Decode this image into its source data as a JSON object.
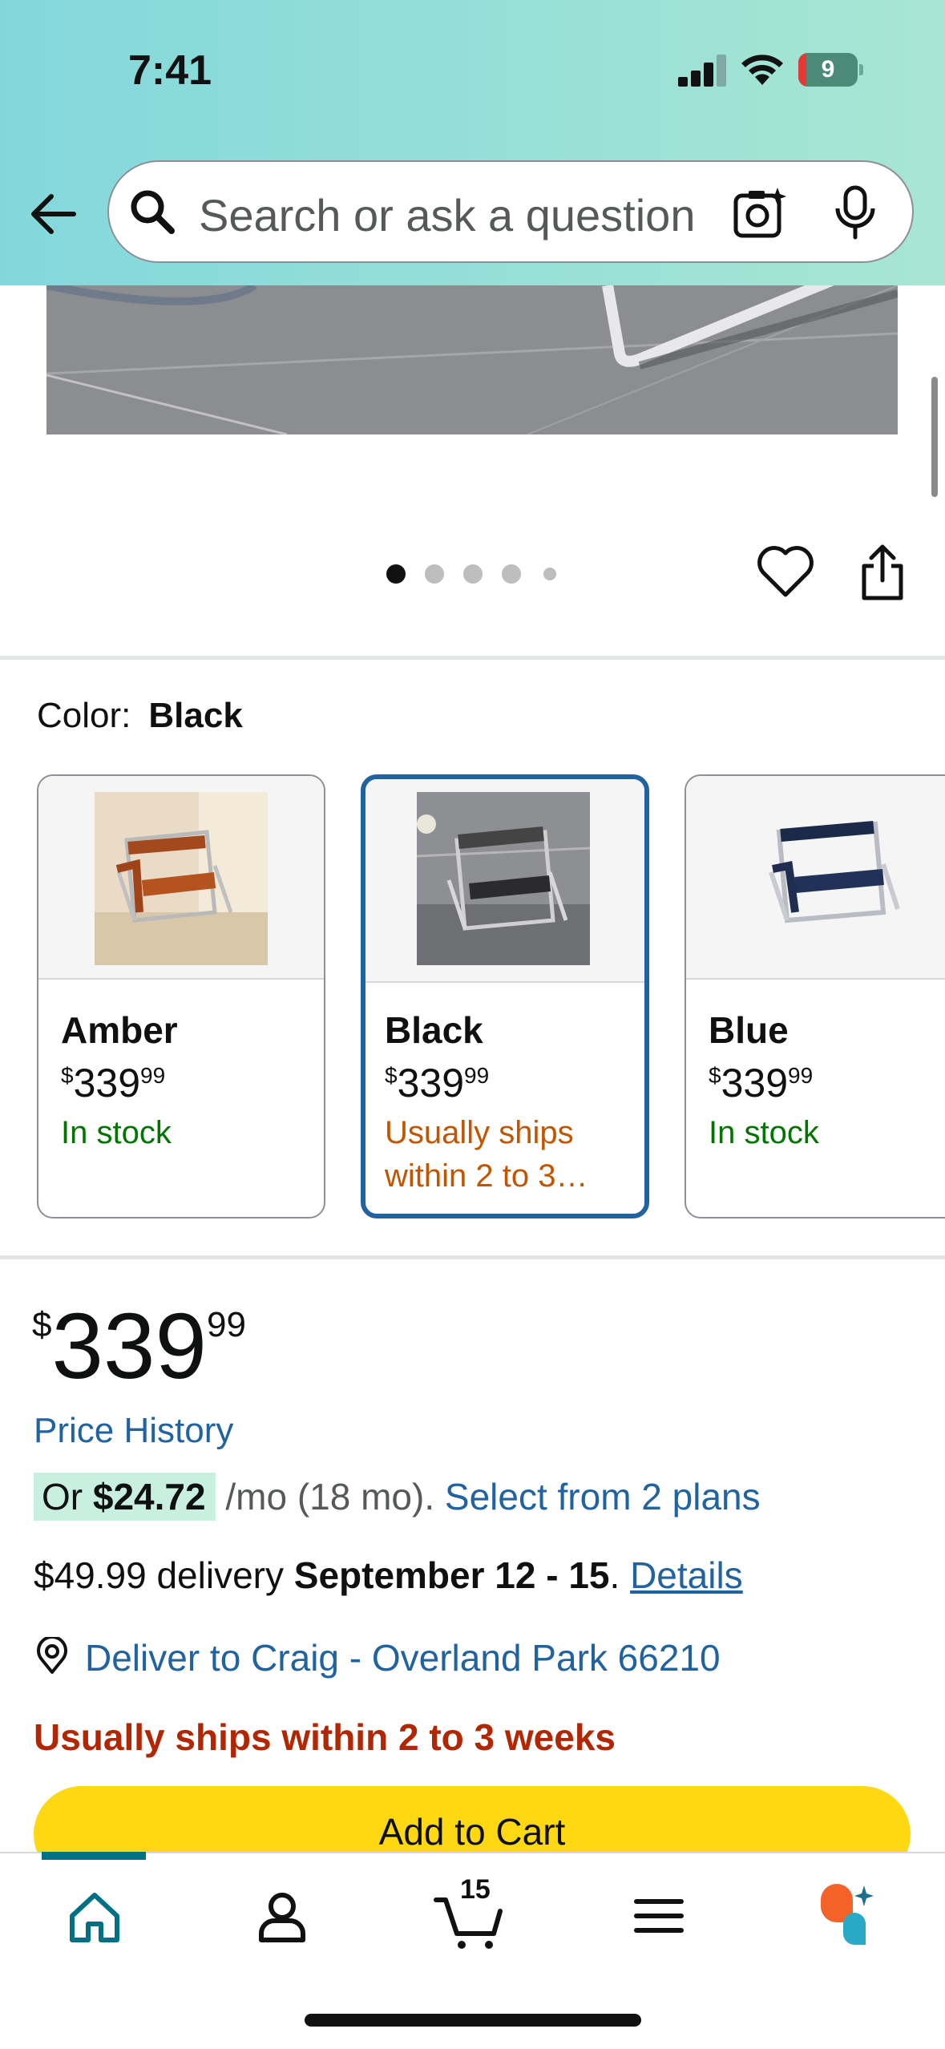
{
  "status_bar": {
    "time": "7:41",
    "battery_level": "9"
  },
  "search": {
    "placeholder": "Search or ask a question"
  },
  "image_pager": {
    "count": 5,
    "active_index": 0
  },
  "color_selector": {
    "label": "Color:",
    "selected": "Black",
    "options": [
      {
        "name": "Amber",
        "price_currency": "$",
        "price_whole": "339",
        "price_fraction": "99",
        "availability": "In stock",
        "selected": false
      },
      {
        "name": "Black",
        "price_currency": "$",
        "price_whole": "339",
        "price_fraction": "99",
        "availability": "Usually ships within 2 to 3…",
        "selected": true
      },
      {
        "name": "Blue",
        "price_currency": "$",
        "price_whole": "339",
        "price_fraction": "99",
        "availability": "In stock",
        "selected": false
      }
    ]
  },
  "price": {
    "currency": "$",
    "whole": "339",
    "fraction": "99",
    "history_link": "Price History"
  },
  "installment": {
    "prefix": "Or",
    "amount": "$24.72",
    "suffix": "/mo (18 mo).",
    "link": "Select from 2 plans"
  },
  "delivery": {
    "fee": "$49.99 delivery",
    "dates": "September 12 - 15",
    "period": ".",
    "details_link": "Details"
  },
  "deliver_to": "Deliver to Craig - Overland Park 66210",
  "shipping_warning": "Usually ships within 2 to 3 weeks",
  "add_to_cart": "Add to Cart",
  "bottom_nav": {
    "cart_count": "15",
    "items": [
      "home",
      "account",
      "cart",
      "menu",
      "rufus"
    ]
  },
  "colors": {
    "header_gradient_start": "#83d7dc",
    "header_gradient_end": "#a8e6d3",
    "link": "#2162a1",
    "selected_border": "#2162a1",
    "in_stock": "#007600",
    "ships_orange": "#c45500",
    "warning_red": "#b12704",
    "add_to_cart_yellow": "#ffd814",
    "nav_active": "#007185"
  }
}
